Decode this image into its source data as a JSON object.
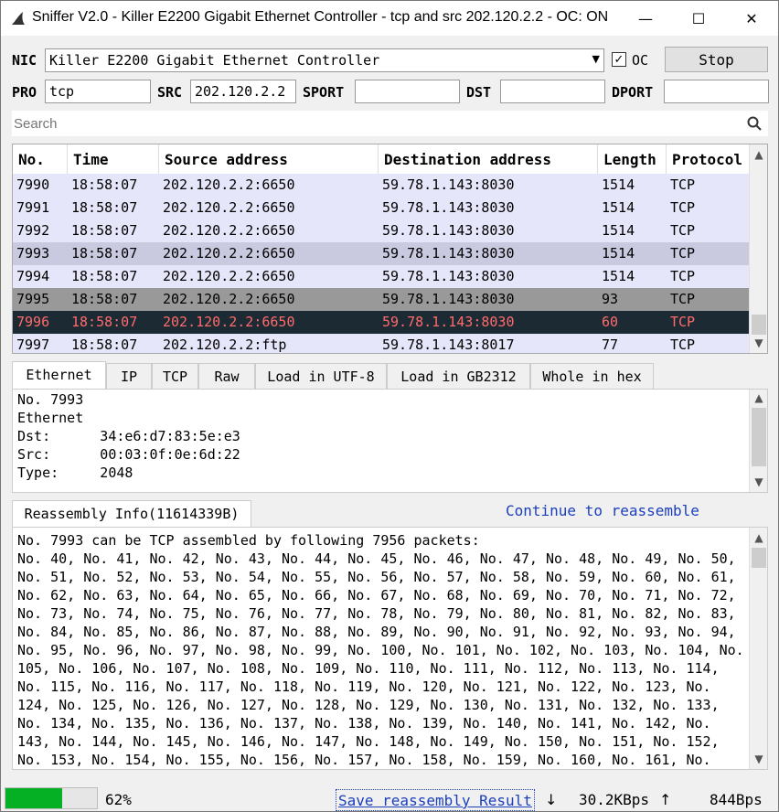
{
  "window": {
    "title": "Sniffer V2.0 - Killer E2200 Gigabit Ethernet Controller - tcp and src 202.120.2.2 - OC: ON",
    "minimize_glyph": "—",
    "maximize_glyph": "☐",
    "close_glyph": "✕"
  },
  "toolbar": {
    "nic_label": "NIC",
    "nic_value": "Killer E2200 Gigabit Ethernet Controller",
    "oc_label": "OC",
    "oc_checked": true,
    "stop_label": "Stop"
  },
  "filters": {
    "pro_label": "PRO",
    "pro_value": "tcp",
    "src_label": "SRC",
    "src_value": "202.120.2.2",
    "sport_label": "SPORT",
    "sport_value": "",
    "dst_label": "DST",
    "dst_value": "",
    "dport_label": "DPORT",
    "dport_value": ""
  },
  "search": {
    "placeholder": "Search"
  },
  "packets": {
    "columns": [
      "No.",
      "Time",
      "Source address",
      "Destination address",
      "Length",
      "Protocol"
    ],
    "rows": [
      {
        "no": "7990",
        "time": "18:58:07",
        "src": "202.120.2.2:6650",
        "dst": "59.78.1.143:8030",
        "len": "1514",
        "proto": "TCP",
        "style": "normal"
      },
      {
        "no": "7991",
        "time": "18:58:07",
        "src": "202.120.2.2:6650",
        "dst": "59.78.1.143:8030",
        "len": "1514",
        "proto": "TCP",
        "style": "normal"
      },
      {
        "no": "7992",
        "time": "18:58:07",
        "src": "202.120.2.2:6650",
        "dst": "59.78.1.143:8030",
        "len": "1514",
        "proto": "TCP",
        "style": "normal"
      },
      {
        "no": "7993",
        "time": "18:58:07",
        "src": "202.120.2.2:6650",
        "dst": "59.78.1.143:8030",
        "len": "1514",
        "proto": "TCP",
        "style": "hover"
      },
      {
        "no": "7994",
        "time": "18:58:07",
        "src": "202.120.2.2:6650",
        "dst": "59.78.1.143:8030",
        "len": "1514",
        "proto": "TCP",
        "style": "normal"
      },
      {
        "no": "7995",
        "time": "18:58:07",
        "src": "202.120.2.2:6650",
        "dst": "59.78.1.143:8030",
        "len": "93",
        "proto": "TCP",
        "style": "gray"
      },
      {
        "no": "7996",
        "time": "18:58:07",
        "src": "202.120.2.2:6650",
        "dst": "59.78.1.143:8030",
        "len": "60",
        "proto": "TCP",
        "style": "selected"
      },
      {
        "no": "7997",
        "time": "18:58:07",
        "src": "202.120.2.2:ftp",
        "dst": "59.78.1.143:8017",
        "len": "77",
        "proto": "TCP",
        "style": "normal"
      }
    ]
  },
  "detail_tabs": [
    "Ethernet",
    "IP",
    "TCP",
    "Raw",
    "Load in UTF-8",
    "Load in GB2312",
    "Whole in hex"
  ],
  "detail": {
    "lines": [
      "No. 7993",
      "Ethernet",
      "Dst:      34:e6:d7:83:5e:e3",
      "Src:      00:03:0f:0e:6d:22",
      "Type:     2048"
    ]
  },
  "reassembly": {
    "tab_label": "Reassembly Info(11614339B)",
    "continue_link": "Continue to reassemble",
    "lines": [
      "No. 7993 can be TCP assembled by following 7956 packets:",
      "No. 40, No. 41, No. 42, No. 43, No. 44, No. 45, No. 46, No. 47, No. 48, No. 49, No. 50,",
      "No. 51, No. 52, No. 53, No. 54, No. 55, No. 56, No. 57, No. 58, No. 59, No. 60, No. 61,",
      "No. 62, No. 63, No. 64, No. 65, No. 66, No. 67, No. 68, No. 69, No. 70, No. 71, No. 72,",
      "No. 73, No. 74, No. 75, No. 76, No. 77, No. 78, No. 79, No. 80, No. 81, No. 82, No. 83,",
      "No. 84, No. 85, No. 86, No. 87, No. 88, No. 89, No. 90, No. 91, No. 92, No. 93, No. 94,",
      "No. 95, No. 96, No. 97, No. 98, No. 99, No. 100, No. 101, No. 102, No. 103, No. 104, No.",
      "105, No. 106, No. 107, No. 108, No. 109, No. 110, No. 111, No. 112, No. 113, No. 114,",
      "No. 115, No. 116, No. 117, No. 118, No. 119, No. 120, No. 121, No. 122, No. 123, No.",
      "124, No. 125, No. 126, No. 127, No. 128, No. 129, No. 130, No. 131, No. 132, No. 133,",
      "No. 134, No. 135, No. 136, No. 137, No. 138, No. 139, No. 140, No. 141, No. 142, No.",
      "143, No. 144, No. 145, No. 146, No. 147, No. 148, No. 149, No. 150, No. 151, No. 152,",
      "No. 153, No. 154, No. 155, No. 156, No. 157, No. 158, No. 159, No. 160, No. 161, No."
    ]
  },
  "status": {
    "progress_fraction": 0.62,
    "progress_text": "62%",
    "save_label": "Save reassembly Result",
    "down_glyph": "↓",
    "down_rate": "30.2KBps",
    "up_glyph": "↑",
    "up_rate": "844Bps"
  },
  "colors": {
    "row_normal": "#e6e6fa",
    "row_hover": "#c9c9e0",
    "row_gray": "#999999",
    "row_selected": "#1c2a33",
    "row_selected_text": "#ff6b6b",
    "link": "#1a3ebd",
    "progress": "#06b025"
  },
  "icons": {
    "app": "shark-fin-icon",
    "search": "search-icon",
    "dropdown": "chevron-down-icon"
  }
}
